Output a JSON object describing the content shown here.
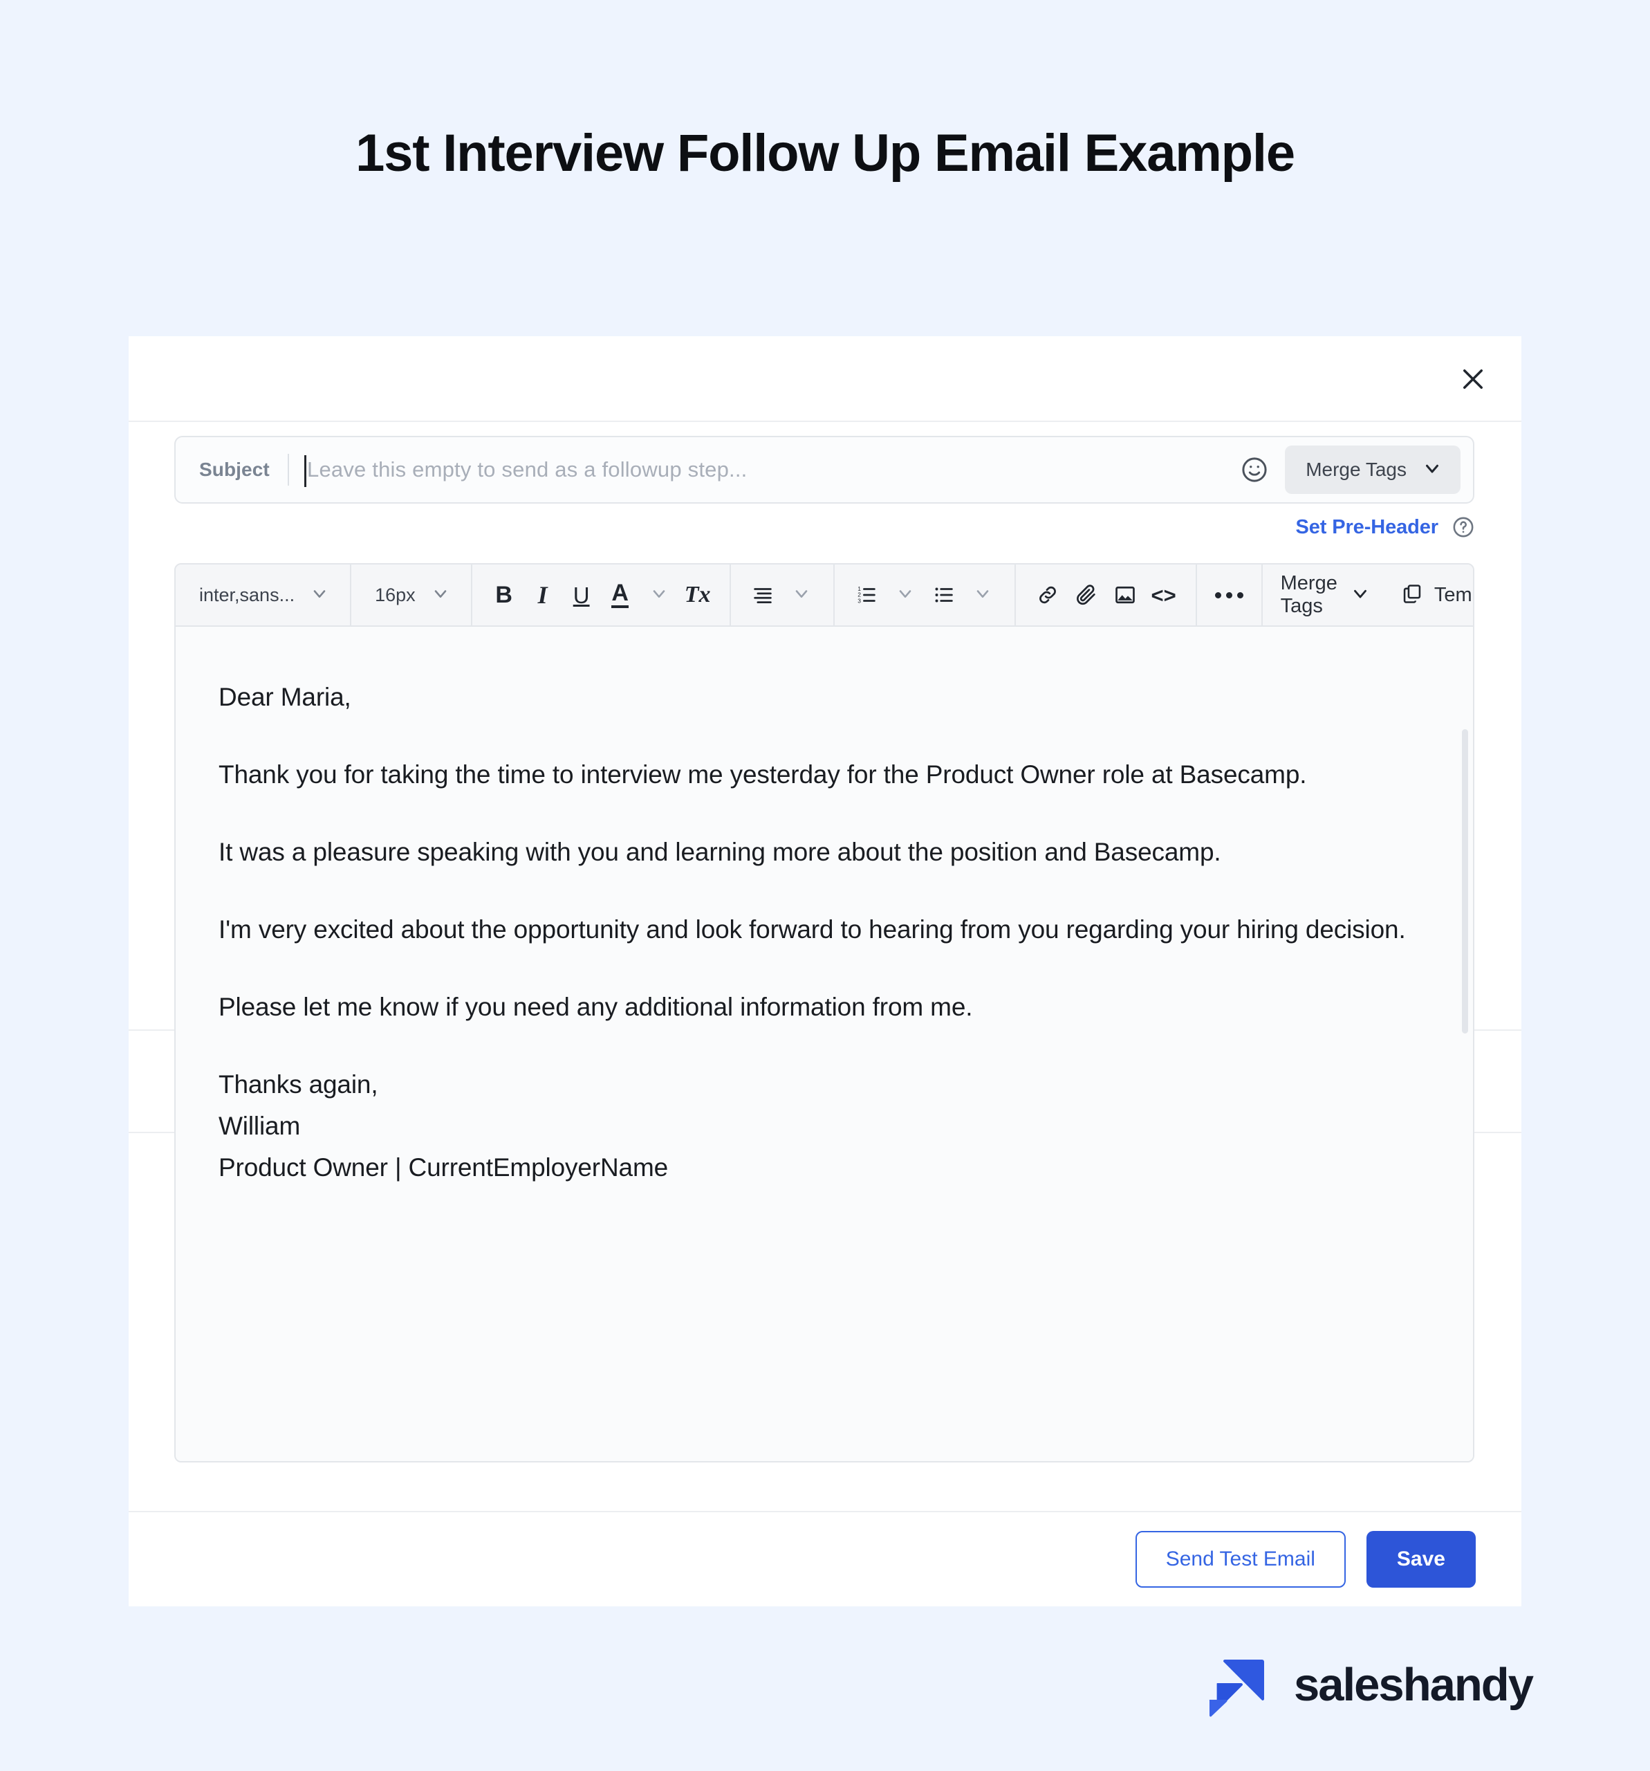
{
  "page": {
    "title": "1st Interview Follow Up Email Example",
    "background_color": "#eef4fe"
  },
  "modal": {
    "close_icon": "close-icon"
  },
  "subject": {
    "label": "Subject",
    "placeholder": "Leave this empty to send as a followup step...",
    "value": "",
    "emoji_icon": "emoji-smiley-icon",
    "merge_tags_label": "Merge Tags",
    "chevron_icon": "chevron-down-icon"
  },
  "preheader": {
    "link_label": "Set Pre-Header",
    "link_color": "#3565e3",
    "help_icon": "question-circle-icon"
  },
  "toolbar": {
    "font_family_value": "inter,sans...",
    "font_size_value": "16px",
    "bold_label": "B",
    "italic_label": "I",
    "underline_label": "U",
    "text_color_label": "A",
    "clear_format_label": "Tx",
    "align_icon": "align-icon",
    "ordered_list_icon": "ordered-list-icon",
    "bullet_list_icon": "bullet-list-icon",
    "link_icon": "link-icon",
    "attachment_icon": "paperclip-icon",
    "image_icon": "image-icon",
    "code_label": "<>",
    "more_icon": "more-horizontal-icon",
    "merge_tags_label": "Merge Tags",
    "template_label": "Template",
    "template_icon": "copy-icon"
  },
  "email_body": {
    "greeting": "Dear Maria,",
    "paragraph_1": "Thank you for taking the time to interview me yesterday for the Product Owner role at Basecamp.",
    "paragraph_2": "It was a pleasure speaking with you and learning more about the position and Basecamp.",
    "paragraph_3": "I'm very excited about the opportunity and look forward to hearing from you regarding your hiring decision.",
    "paragraph_4": "Please let me know if you need any additional information from me.",
    "signoff": "Thanks again,",
    "sender_name": "William",
    "sender_title": "Product Owner | CurrentEmployerName"
  },
  "footer": {
    "send_test_label": "Send Test Email",
    "save_label": "Save",
    "primary_color": "#2d55d8",
    "link_color": "#3565e3"
  },
  "brand": {
    "name": "saleshandy",
    "logo_icon": "saleshandy-logo-icon",
    "mark_color": "#2f58e0",
    "text_color": "#141a28"
  }
}
